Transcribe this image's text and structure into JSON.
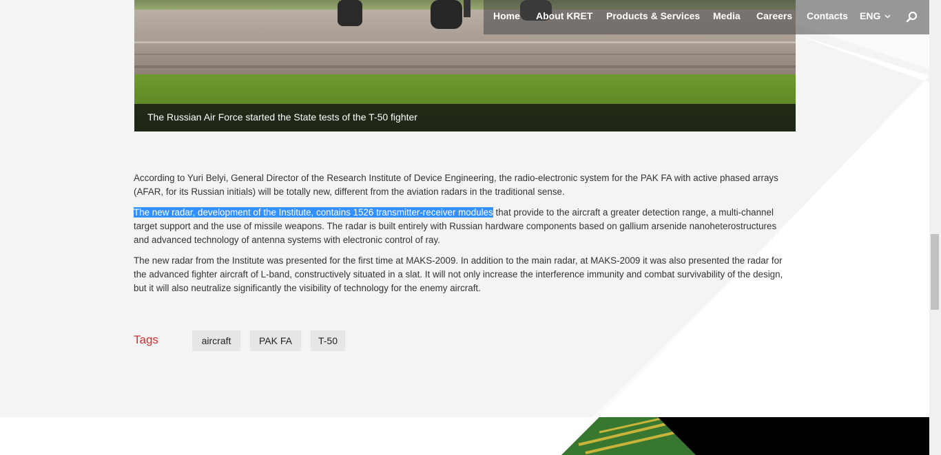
{
  "nav": {
    "items": [
      "Home",
      "About KRET",
      "Products & Services",
      "Media",
      "Careers",
      "Contacts"
    ],
    "language": "ENG"
  },
  "hero": {
    "caption": "The Russian Air Force started the State tests of the T-50 fighter"
  },
  "article": {
    "p1": "According to Yuri Belyi, General Director of the Research Institute of Device Engineering, the radio-electronic system for the PAK FA with active phased arrays (AFAR,  for its Russian initials) will be totally new, different from the aviation radars in the traditional sense.",
    "p2_highlight": "The new radar, development of the Institute, contains 1526 transmitter-receiver modules",
    "p2_rest": " that provide to the aircraft a greater detection range, a multi-channel target support and the use of missile weapons. The radar is built entirely with Russian hardware components based on gallium arsenide nanoheterostructures and advanced technology of antenna systems with electronic control of ray.",
    "p3": "The new radar from the Institute was presented for the first time at MAKS-2009. In addition to the main radar, at MAKS-2009 it was also presented the radar for the advanced fighter aircraft of L-band, constructively situated in a slat. It will not only increase the interference immunity and combat survivability of the design, but it will also neutralize significantly the visibility of technology for the enemy aircraft."
  },
  "tags": {
    "label": "Tags",
    "items": [
      "aircraft",
      "PAK FA",
      "T-50"
    ]
  },
  "colors": {
    "accent": "#d32f2f",
    "highlight": "#3390ff"
  },
  "icons": {
    "search": "search-icon",
    "language_dropdown": "chevron-down-icon"
  }
}
